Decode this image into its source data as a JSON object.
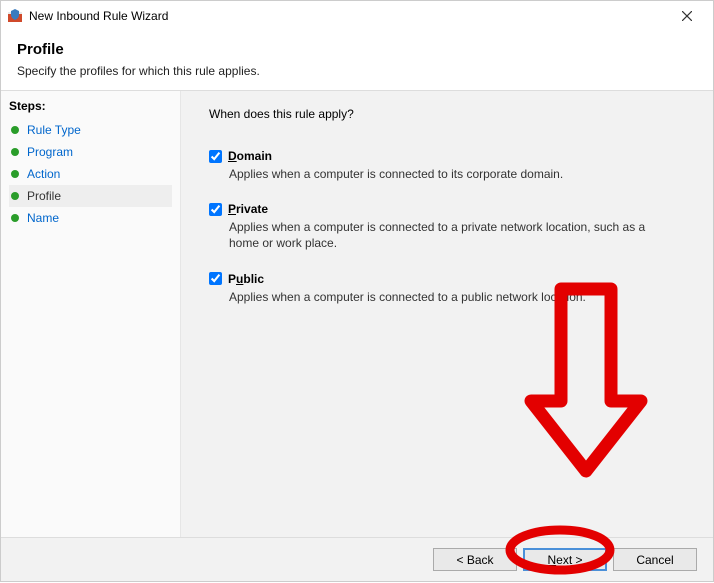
{
  "window": {
    "title": "New Inbound Rule Wizard"
  },
  "header": {
    "heading": "Profile",
    "description": "Specify the profiles for which this rule applies."
  },
  "steps": {
    "label": "Steps:",
    "items": [
      {
        "label": "Rule Type",
        "current": false
      },
      {
        "label": "Program",
        "current": false
      },
      {
        "label": "Action",
        "current": false
      },
      {
        "label": "Profile",
        "current": true
      },
      {
        "label": "Name",
        "current": false
      }
    ]
  },
  "content": {
    "question": "When does this rule apply?",
    "options": [
      {
        "key": "domain",
        "label_prefix": "D",
        "label_rest": "omain",
        "checked": true,
        "description": "Applies when a computer is connected to its corporate domain."
      },
      {
        "key": "private",
        "label_prefix": "P",
        "label_rest": "rivate",
        "checked": true,
        "description": "Applies when a computer is connected to a private network location, such as a home or work place."
      },
      {
        "key": "public",
        "label_prefix": "u",
        "label_pre": "P",
        "label_rest": "blic",
        "checked": true,
        "description": "Applies when a computer is connected to a public network location."
      }
    ]
  },
  "footer": {
    "back": "< Back",
    "next": "Next >",
    "cancel": "Cancel"
  }
}
